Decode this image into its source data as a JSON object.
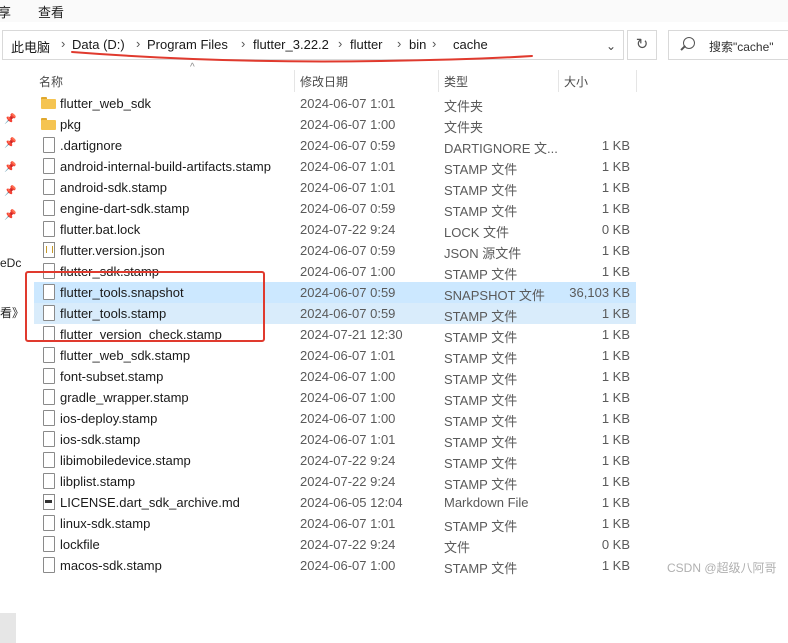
{
  "ribbon": {
    "left_fragment": "享",
    "view_label": "查看"
  },
  "address": {
    "crumbs": [
      "此电脑",
      "Data (D:)",
      "Program Files",
      "flutter_3.22.2",
      "flutter",
      "bin",
      "cache"
    ],
    "separator": "›",
    "dropdown": "⌄",
    "refresh": "↻"
  },
  "search": {
    "placeholder": "搜索\"cache\""
  },
  "left_pane": {
    "frag1": "eDc",
    "frag2": "看》."
  },
  "columns": {
    "name": "名称",
    "date": "修改日期",
    "type": "类型",
    "size": "大小"
  },
  "files": [
    {
      "name": "flutter_web_sdk",
      "date": "2024-06-07 1:01",
      "type": "文件夹",
      "size": "",
      "icon": "folder"
    },
    {
      "name": "pkg",
      "date": "2024-06-07 1:00",
      "type": "文件夹",
      "size": "",
      "icon": "folder"
    },
    {
      "name": ".dartignore",
      "date": "2024-06-07 0:59",
      "type": "DARTIGNORE 文...",
      "size": "1 KB",
      "icon": "file"
    },
    {
      "name": "android-internal-build-artifacts.stamp",
      "date": "2024-06-07 1:01",
      "type": "STAMP 文件",
      "size": "1 KB",
      "icon": "file"
    },
    {
      "name": "android-sdk.stamp",
      "date": "2024-06-07 1:01",
      "type": "STAMP 文件",
      "size": "1 KB",
      "icon": "file"
    },
    {
      "name": "engine-dart-sdk.stamp",
      "date": "2024-06-07 0:59",
      "type": "STAMP 文件",
      "size": "1 KB",
      "icon": "file"
    },
    {
      "name": "flutter.bat.lock",
      "date": "2024-07-22 9:24",
      "type": "LOCK 文件",
      "size": "0 KB",
      "icon": "file"
    },
    {
      "name": "flutter.version.json",
      "date": "2024-06-07 0:59",
      "type": "JSON 源文件",
      "size": "1 KB",
      "icon": "json"
    },
    {
      "name": "flutter_sdk.stamp",
      "date": "2024-06-07 1:00",
      "type": "STAMP 文件",
      "size": "1 KB",
      "icon": "file"
    },
    {
      "name": "flutter_tools.snapshot",
      "date": "2024-06-07 0:59",
      "type": "SNAPSHOT 文件",
      "size": "36,103 KB",
      "icon": "file",
      "selected": true
    },
    {
      "name": "flutter_tools.stamp",
      "date": "2024-06-07 0:59",
      "type": "STAMP 文件",
      "size": "1 KB",
      "icon": "file",
      "selected": true
    },
    {
      "name": "flutter_version_check.stamp",
      "date": "2024-07-21 12:30",
      "type": "STAMP 文件",
      "size": "1 KB",
      "icon": "file"
    },
    {
      "name": "flutter_web_sdk.stamp",
      "date": "2024-06-07 1:01",
      "type": "STAMP 文件",
      "size": "1 KB",
      "icon": "file"
    },
    {
      "name": "font-subset.stamp",
      "date": "2024-06-07 1:00",
      "type": "STAMP 文件",
      "size": "1 KB",
      "icon": "file"
    },
    {
      "name": "gradle_wrapper.stamp",
      "date": "2024-06-07 1:00",
      "type": "STAMP 文件",
      "size": "1 KB",
      "icon": "file"
    },
    {
      "name": "ios-deploy.stamp",
      "date": "2024-06-07 1:00",
      "type": "STAMP 文件",
      "size": "1 KB",
      "icon": "file"
    },
    {
      "name": "ios-sdk.stamp",
      "date": "2024-06-07 1:01",
      "type": "STAMP 文件",
      "size": "1 KB",
      "icon": "file"
    },
    {
      "name": "libimobiledevice.stamp",
      "date": "2024-07-22 9:24",
      "type": "STAMP 文件",
      "size": "1 KB",
      "icon": "file"
    },
    {
      "name": "libplist.stamp",
      "date": "2024-07-22 9:24",
      "type": "STAMP 文件",
      "size": "1 KB",
      "icon": "file"
    },
    {
      "name": "LICENSE.dart_sdk_archive.md",
      "date": "2024-06-05 12:04",
      "type": "Markdown File",
      "size": "1 KB",
      "icon": "md"
    },
    {
      "name": "linux-sdk.stamp",
      "date": "2024-06-07 1:01",
      "type": "STAMP 文件",
      "size": "1 KB",
      "icon": "file"
    },
    {
      "name": "lockfile",
      "date": "2024-07-22 9:24",
      "type": "文件",
      "size": "0 KB",
      "icon": "file"
    },
    {
      "name": "macos-sdk.stamp",
      "date": "2024-06-07 1:00",
      "type": "STAMP 文件",
      "size": "1 KB",
      "icon": "file"
    }
  ],
  "watermark": "CSDN @超级八阿哥",
  "colors": {
    "selection": "#cce8ff",
    "annotation_red": "#e03a2e",
    "folder": "#f5c451"
  }
}
